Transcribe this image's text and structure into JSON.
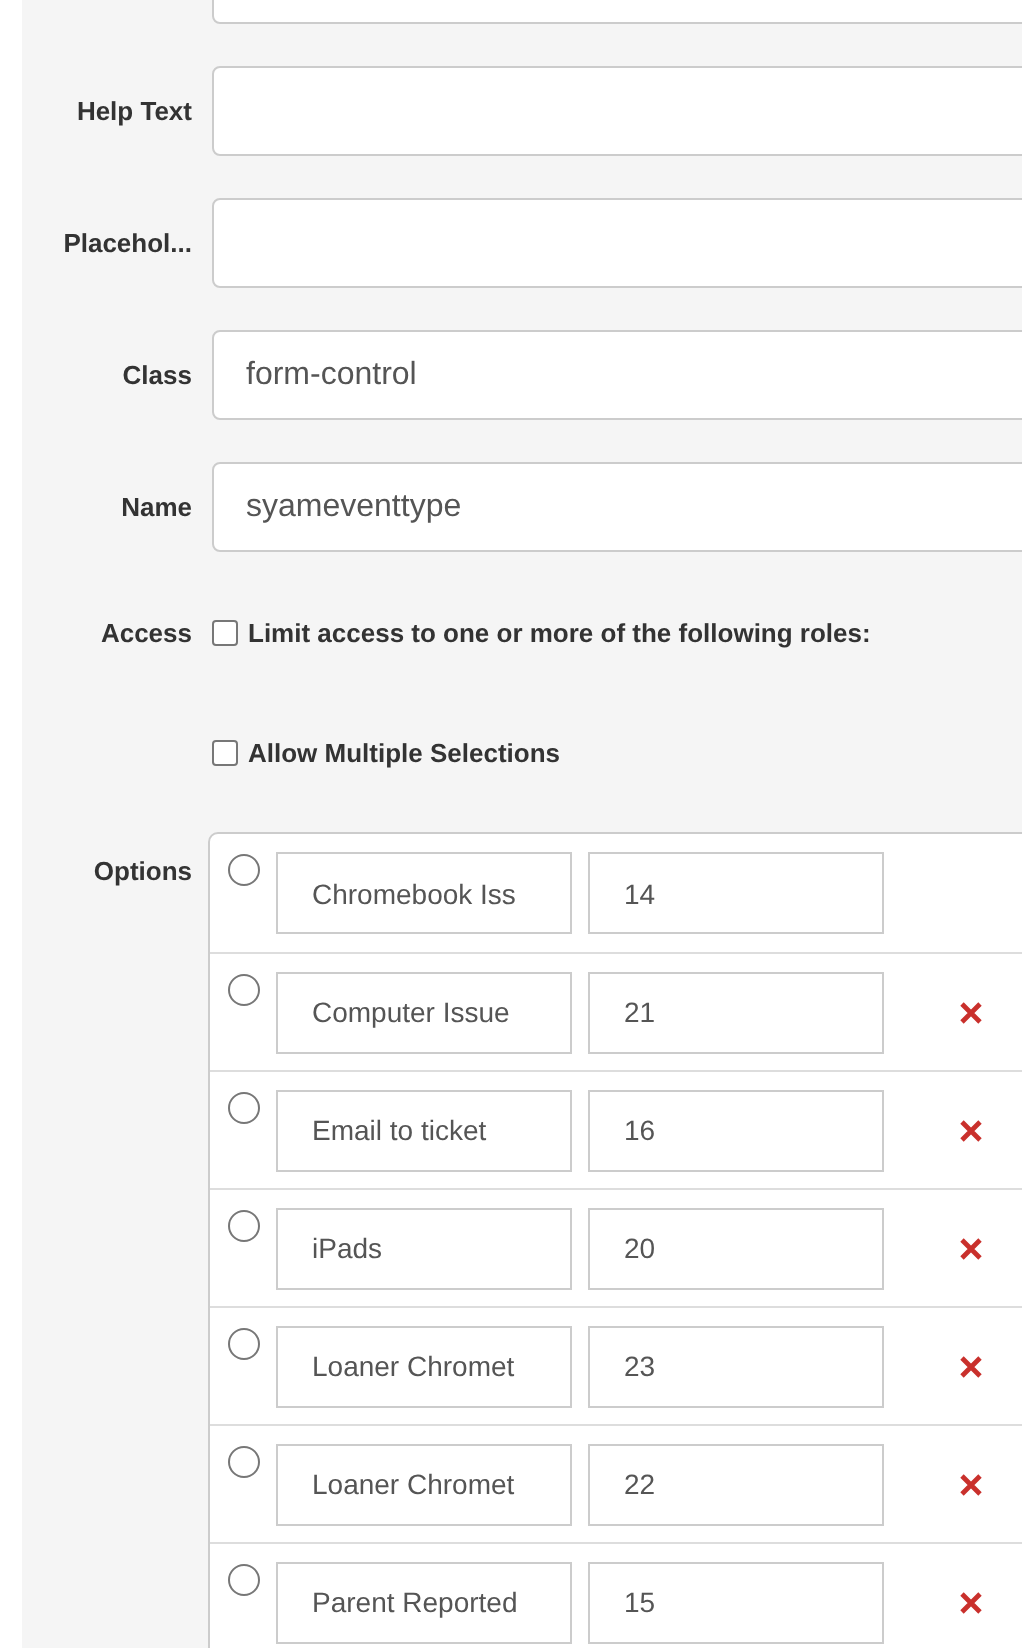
{
  "fields": [
    {
      "label": "Help Text"
    },
    {
      "label": "Placehol..."
    },
    {
      "label": "Class",
      "value": "form-control"
    },
    {
      "label": "Name",
      "value": "syameventtype"
    }
  ],
  "access": {
    "label": "Access",
    "checkbox": {
      "label": "Limit access to one or more of the following roles:",
      "checked": false
    }
  },
  "multiple": {
    "label": "Allow Multiple Selections",
    "checked": false
  },
  "options": {
    "label": "Options",
    "rows": [
      {
        "text": "Chromebook Iss",
        "value": "14",
        "selected": false,
        "deletable": false
      },
      {
        "text": "Computer Issue",
        "value": "21",
        "selected": false,
        "deletable": true
      },
      {
        "text": "Email to ticket",
        "value": "16",
        "selected": false,
        "deletable": true
      },
      {
        "text": "iPads",
        "value": "20",
        "selected": false,
        "deletable": true
      },
      {
        "text": "Loaner Chromet",
        "value": "23",
        "selected": false,
        "deletable": true
      },
      {
        "text": "Loaner Chromet",
        "value": "22",
        "selected": false,
        "deletable": true
      },
      {
        "text": "Parent Reported",
        "value": "15",
        "selected": false,
        "deletable": true
      }
    ]
  }
}
